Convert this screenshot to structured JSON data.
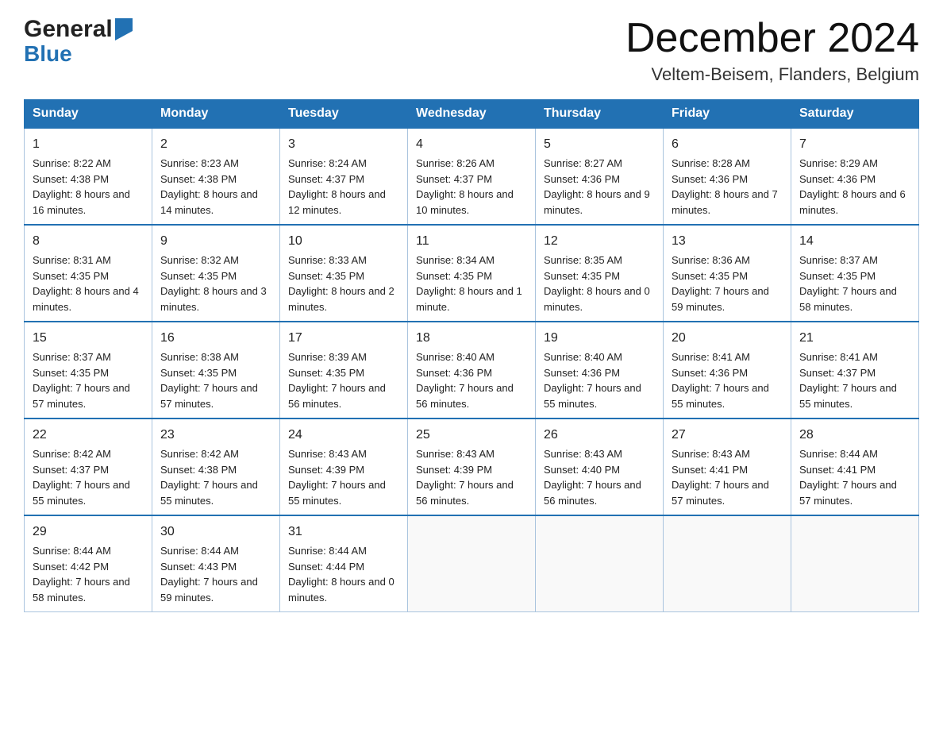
{
  "header": {
    "logo_general": "General",
    "logo_blue": "Blue",
    "month_title": "December 2024",
    "location": "Veltem-Beisem, Flanders, Belgium"
  },
  "days_of_week": [
    "Sunday",
    "Monday",
    "Tuesday",
    "Wednesday",
    "Thursday",
    "Friday",
    "Saturday"
  ],
  "weeks": [
    [
      {
        "day": "1",
        "sunrise": "Sunrise: 8:22 AM",
        "sunset": "Sunset: 4:38 PM",
        "daylight": "Daylight: 8 hours and 16 minutes."
      },
      {
        "day": "2",
        "sunrise": "Sunrise: 8:23 AM",
        "sunset": "Sunset: 4:38 PM",
        "daylight": "Daylight: 8 hours and 14 minutes."
      },
      {
        "day": "3",
        "sunrise": "Sunrise: 8:24 AM",
        "sunset": "Sunset: 4:37 PM",
        "daylight": "Daylight: 8 hours and 12 minutes."
      },
      {
        "day": "4",
        "sunrise": "Sunrise: 8:26 AM",
        "sunset": "Sunset: 4:37 PM",
        "daylight": "Daylight: 8 hours and 10 minutes."
      },
      {
        "day": "5",
        "sunrise": "Sunrise: 8:27 AM",
        "sunset": "Sunset: 4:36 PM",
        "daylight": "Daylight: 8 hours and 9 minutes."
      },
      {
        "day": "6",
        "sunrise": "Sunrise: 8:28 AM",
        "sunset": "Sunset: 4:36 PM",
        "daylight": "Daylight: 8 hours and 7 minutes."
      },
      {
        "day": "7",
        "sunrise": "Sunrise: 8:29 AM",
        "sunset": "Sunset: 4:36 PM",
        "daylight": "Daylight: 8 hours and 6 minutes."
      }
    ],
    [
      {
        "day": "8",
        "sunrise": "Sunrise: 8:31 AM",
        "sunset": "Sunset: 4:35 PM",
        "daylight": "Daylight: 8 hours and 4 minutes."
      },
      {
        "day": "9",
        "sunrise": "Sunrise: 8:32 AM",
        "sunset": "Sunset: 4:35 PM",
        "daylight": "Daylight: 8 hours and 3 minutes."
      },
      {
        "day": "10",
        "sunrise": "Sunrise: 8:33 AM",
        "sunset": "Sunset: 4:35 PM",
        "daylight": "Daylight: 8 hours and 2 minutes."
      },
      {
        "day": "11",
        "sunrise": "Sunrise: 8:34 AM",
        "sunset": "Sunset: 4:35 PM",
        "daylight": "Daylight: 8 hours and 1 minute."
      },
      {
        "day": "12",
        "sunrise": "Sunrise: 8:35 AM",
        "sunset": "Sunset: 4:35 PM",
        "daylight": "Daylight: 8 hours and 0 minutes."
      },
      {
        "day": "13",
        "sunrise": "Sunrise: 8:36 AM",
        "sunset": "Sunset: 4:35 PM",
        "daylight": "Daylight: 7 hours and 59 minutes."
      },
      {
        "day": "14",
        "sunrise": "Sunrise: 8:37 AM",
        "sunset": "Sunset: 4:35 PM",
        "daylight": "Daylight: 7 hours and 58 minutes."
      }
    ],
    [
      {
        "day": "15",
        "sunrise": "Sunrise: 8:37 AM",
        "sunset": "Sunset: 4:35 PM",
        "daylight": "Daylight: 7 hours and 57 minutes."
      },
      {
        "day": "16",
        "sunrise": "Sunrise: 8:38 AM",
        "sunset": "Sunset: 4:35 PM",
        "daylight": "Daylight: 7 hours and 57 minutes."
      },
      {
        "day": "17",
        "sunrise": "Sunrise: 8:39 AM",
        "sunset": "Sunset: 4:35 PM",
        "daylight": "Daylight: 7 hours and 56 minutes."
      },
      {
        "day": "18",
        "sunrise": "Sunrise: 8:40 AM",
        "sunset": "Sunset: 4:36 PM",
        "daylight": "Daylight: 7 hours and 56 minutes."
      },
      {
        "day": "19",
        "sunrise": "Sunrise: 8:40 AM",
        "sunset": "Sunset: 4:36 PM",
        "daylight": "Daylight: 7 hours and 55 minutes."
      },
      {
        "day": "20",
        "sunrise": "Sunrise: 8:41 AM",
        "sunset": "Sunset: 4:36 PM",
        "daylight": "Daylight: 7 hours and 55 minutes."
      },
      {
        "day": "21",
        "sunrise": "Sunrise: 8:41 AM",
        "sunset": "Sunset: 4:37 PM",
        "daylight": "Daylight: 7 hours and 55 minutes."
      }
    ],
    [
      {
        "day": "22",
        "sunrise": "Sunrise: 8:42 AM",
        "sunset": "Sunset: 4:37 PM",
        "daylight": "Daylight: 7 hours and 55 minutes."
      },
      {
        "day": "23",
        "sunrise": "Sunrise: 8:42 AM",
        "sunset": "Sunset: 4:38 PM",
        "daylight": "Daylight: 7 hours and 55 minutes."
      },
      {
        "day": "24",
        "sunrise": "Sunrise: 8:43 AM",
        "sunset": "Sunset: 4:39 PM",
        "daylight": "Daylight: 7 hours and 55 minutes."
      },
      {
        "day": "25",
        "sunrise": "Sunrise: 8:43 AM",
        "sunset": "Sunset: 4:39 PM",
        "daylight": "Daylight: 7 hours and 56 minutes."
      },
      {
        "day": "26",
        "sunrise": "Sunrise: 8:43 AM",
        "sunset": "Sunset: 4:40 PM",
        "daylight": "Daylight: 7 hours and 56 minutes."
      },
      {
        "day": "27",
        "sunrise": "Sunrise: 8:43 AM",
        "sunset": "Sunset: 4:41 PM",
        "daylight": "Daylight: 7 hours and 57 minutes."
      },
      {
        "day": "28",
        "sunrise": "Sunrise: 8:44 AM",
        "sunset": "Sunset: 4:41 PM",
        "daylight": "Daylight: 7 hours and 57 minutes."
      }
    ],
    [
      {
        "day": "29",
        "sunrise": "Sunrise: 8:44 AM",
        "sunset": "Sunset: 4:42 PM",
        "daylight": "Daylight: 7 hours and 58 minutes."
      },
      {
        "day": "30",
        "sunrise": "Sunrise: 8:44 AM",
        "sunset": "Sunset: 4:43 PM",
        "daylight": "Daylight: 7 hours and 59 minutes."
      },
      {
        "day": "31",
        "sunrise": "Sunrise: 8:44 AM",
        "sunset": "Sunset: 4:44 PM",
        "daylight": "Daylight: 8 hours and 0 minutes."
      },
      null,
      null,
      null,
      null
    ]
  ]
}
